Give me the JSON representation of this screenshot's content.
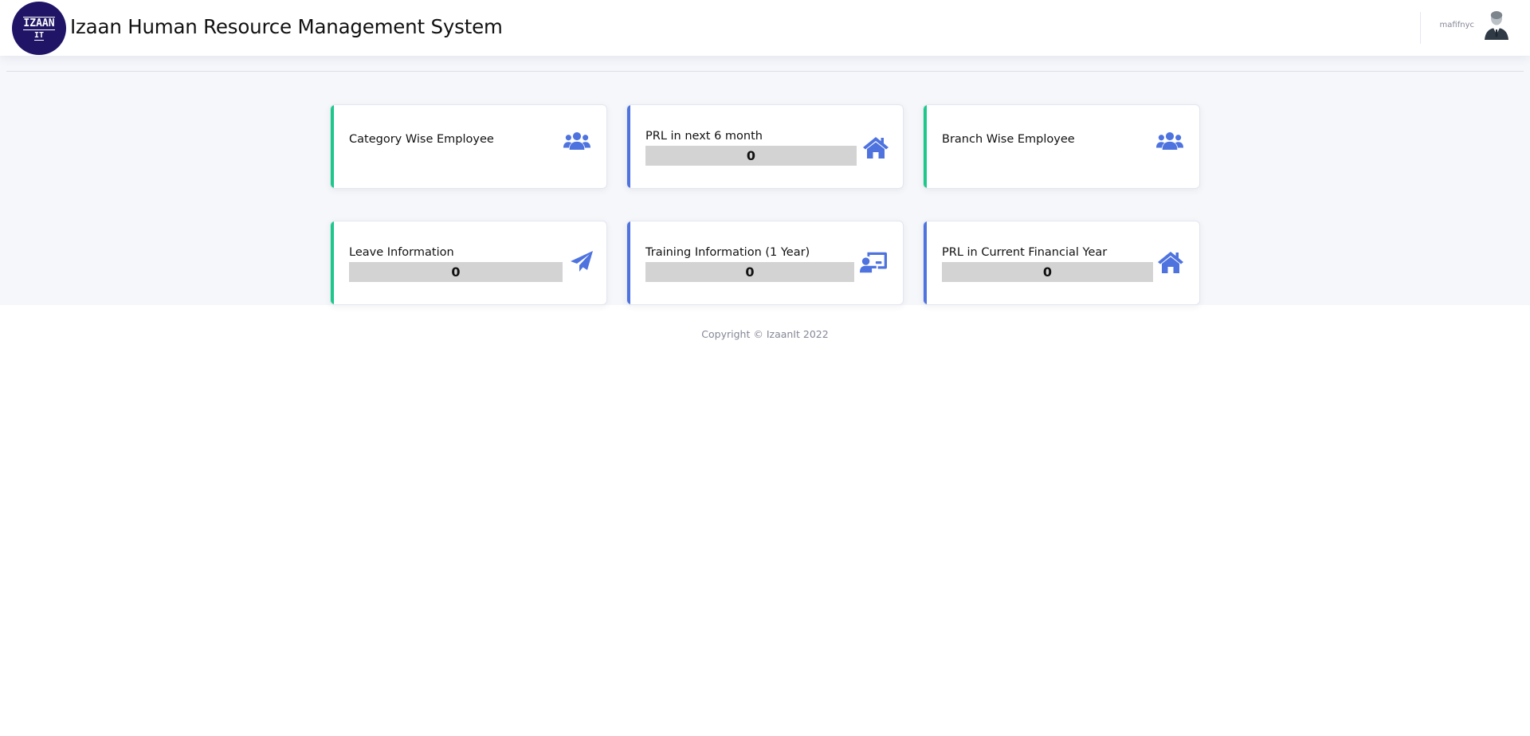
{
  "header": {
    "logo_line1": "IZAAN",
    "logo_line2": "IT",
    "title": "Izaan Human Resource Management System",
    "user_name": "mafifnyc"
  },
  "cards": [
    {
      "title": "Category Wise Employee",
      "value": null,
      "icon": "users-icon",
      "accent": "#1cc88a"
    },
    {
      "title": "PRL in next 6 month",
      "value": "0",
      "icon": "home-icon",
      "accent": "#4e73df"
    },
    {
      "title": "Branch Wise Employee",
      "value": null,
      "icon": "users-icon",
      "accent": "#1cc88a"
    },
    {
      "title": "Leave Information",
      "value": "0",
      "icon": "paper-plane-icon",
      "accent": "#1cc88a"
    },
    {
      "title": "Training Information (1 Year)",
      "value": "0",
      "icon": "chalkboard-teacher-icon",
      "accent": "#4e73df"
    },
    {
      "title": "PRL in Current Financial Year",
      "value": "0",
      "icon": "home-icon",
      "accent": "#4e73df"
    }
  ],
  "colors": {
    "icon": "#4e73df",
    "accent_green": "#1cc88a",
    "accent_blue": "#4e73df",
    "logo_bg": "#1f1466"
  },
  "footer": {
    "copyright": "Copyright © IzaanIt 2022"
  }
}
